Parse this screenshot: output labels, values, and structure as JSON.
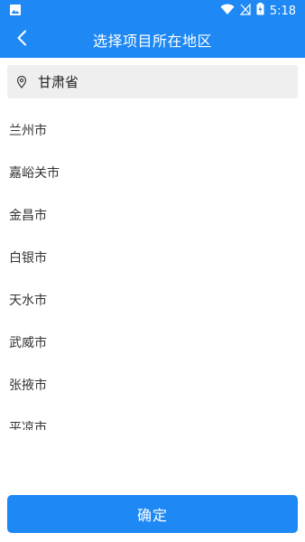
{
  "status_bar": {
    "time": "5:18",
    "icons": [
      "image-icon",
      "wifi-icon",
      "no-signal-icon",
      "battery-charging-icon"
    ]
  },
  "app_bar": {
    "title": "选择项目所在地区",
    "back_icon": "chevron-left-icon"
  },
  "province": {
    "icon": "location-pin-icon",
    "label": "甘肃省"
  },
  "cities": [
    {
      "label": "兰州市"
    },
    {
      "label": "嘉峪关市"
    },
    {
      "label": "金昌市"
    },
    {
      "label": "白银市"
    },
    {
      "label": "天水市"
    },
    {
      "label": "武威市"
    },
    {
      "label": "张掖市"
    },
    {
      "label": "平凉市"
    }
  ],
  "confirm_button": {
    "label": "确定"
  },
  "colors": {
    "accent": "#1e88f5",
    "province_bg": "#efefef"
  }
}
